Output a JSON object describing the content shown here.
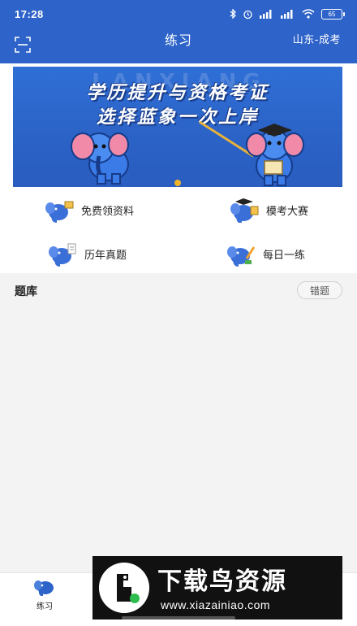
{
  "status_bar": {
    "time": "17:28",
    "battery": "65",
    "icons": [
      "bluetooth-icon",
      "alarm-icon",
      "signal-icon",
      "signal-icon",
      "wifi-icon",
      "battery-icon"
    ]
  },
  "header": {
    "title": "练习",
    "region": "山东-成考",
    "scan_icon": "scan-icon",
    "background": "#2e63c9"
  },
  "banner": {
    "watermark": "LANXIANG",
    "line1": "学历提升与资格考证",
    "line2": "选择蓝象一次上岸",
    "dot_color": "#f0b429"
  },
  "menu": {
    "items": [
      {
        "label": "免费领资料",
        "icon": "elephant-book-icon"
      },
      {
        "label": "模考大赛",
        "icon": "elephant-graduate-icon"
      },
      {
        "label": "历年真题",
        "icon": "elephant-paper-icon"
      },
      {
        "label": "每日一练",
        "icon": "elephant-pencil-icon"
      }
    ]
  },
  "question_bank": {
    "title": "题库",
    "wrong_button": "错题"
  },
  "tabbar": {
    "practice_label": "练习",
    "practice_icon": "elephant-icon"
  },
  "watermark": {
    "title": "下载鸟资源",
    "url": "www.xiazainiao.com",
    "logo_icon": "bird-logo-icon"
  }
}
